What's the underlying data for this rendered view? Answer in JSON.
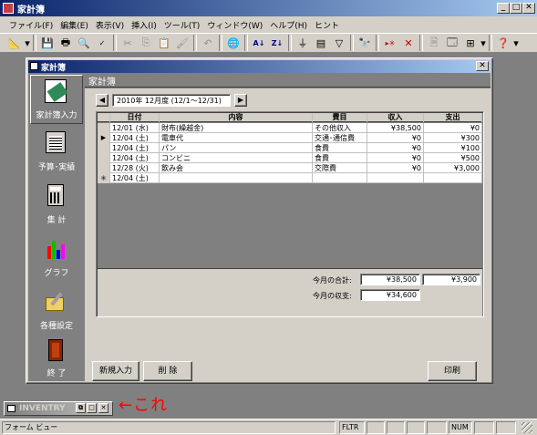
{
  "app": {
    "title": "家計簿"
  },
  "menubar": {
    "items": [
      "ファイル(F)",
      "編集(E)",
      "表示(V)",
      "挿入(I)",
      "ツール(T)",
      "ウィンドウ(W)",
      "ヘルプ(H)",
      "ヒント"
    ]
  },
  "form": {
    "window_title": "家計簿",
    "header_title": "家計簿",
    "period_label": "2010年 12月度 (12/1〜12/31)",
    "sidebar": [
      {
        "label": "家計簿入力",
        "icon": "notebook-pencil-icon"
      },
      {
        "label": "予算･実績",
        "icon": "ledger-icon"
      },
      {
        "label": "集 計",
        "icon": "calculator-icon"
      },
      {
        "label": "グラフ",
        "icon": "bar-chart-icon"
      },
      {
        "label": "各種設定",
        "icon": "folder-tools-icon"
      },
      {
        "label": "終 了",
        "icon": "exit-door-icon"
      }
    ],
    "columns": [
      "日付",
      "内容",
      "費目",
      "収入",
      "支出"
    ],
    "rows": [
      {
        "marker": "",
        "date": "12/01 (水)",
        "content": "財布(繰越金)",
        "category": "その他収入",
        "income": "¥38,500",
        "expense": "¥0"
      },
      {
        "marker": "▶",
        "date": "12/04 (土)",
        "content": "電車代",
        "category": "交通･通信費",
        "income": "¥0",
        "expense": "¥300"
      },
      {
        "marker": "",
        "date": "12/04 (土)",
        "content": "パン",
        "category": "食費",
        "income": "¥0",
        "expense": "¥100"
      },
      {
        "marker": "",
        "date": "12/04 (土)",
        "content": "コンビニ",
        "category": "食費",
        "income": "¥0",
        "expense": "¥500"
      },
      {
        "marker": "",
        "date": "12/28 (火)",
        "content": "飲み会",
        "category": "交際費",
        "income": "¥0",
        "expense": "¥3,000"
      },
      {
        "marker": "✳",
        "date": "12/04 (土)",
        "content": "",
        "category": "",
        "income": "",
        "expense": ""
      }
    ],
    "totals": {
      "month_total_label": "今月の合計:",
      "income_total": "¥38,500",
      "expense_total": "¥3,900",
      "balance_label": "今月の収支:",
      "balance": "¥34,600"
    },
    "buttons": {
      "new": "新規入力",
      "delete": "削 除",
      "print": "印刷"
    }
  },
  "minimized": {
    "title": "INVENTRY",
    "annotation": "←これ"
  },
  "statusbar": {
    "text": "フォーム ビュー",
    "fltr": "FLTR",
    "num": "NUM"
  },
  "colors": {
    "title_active": "#0a246a",
    "form_bg": "#808080",
    "annotation_red": "#ff0000"
  }
}
